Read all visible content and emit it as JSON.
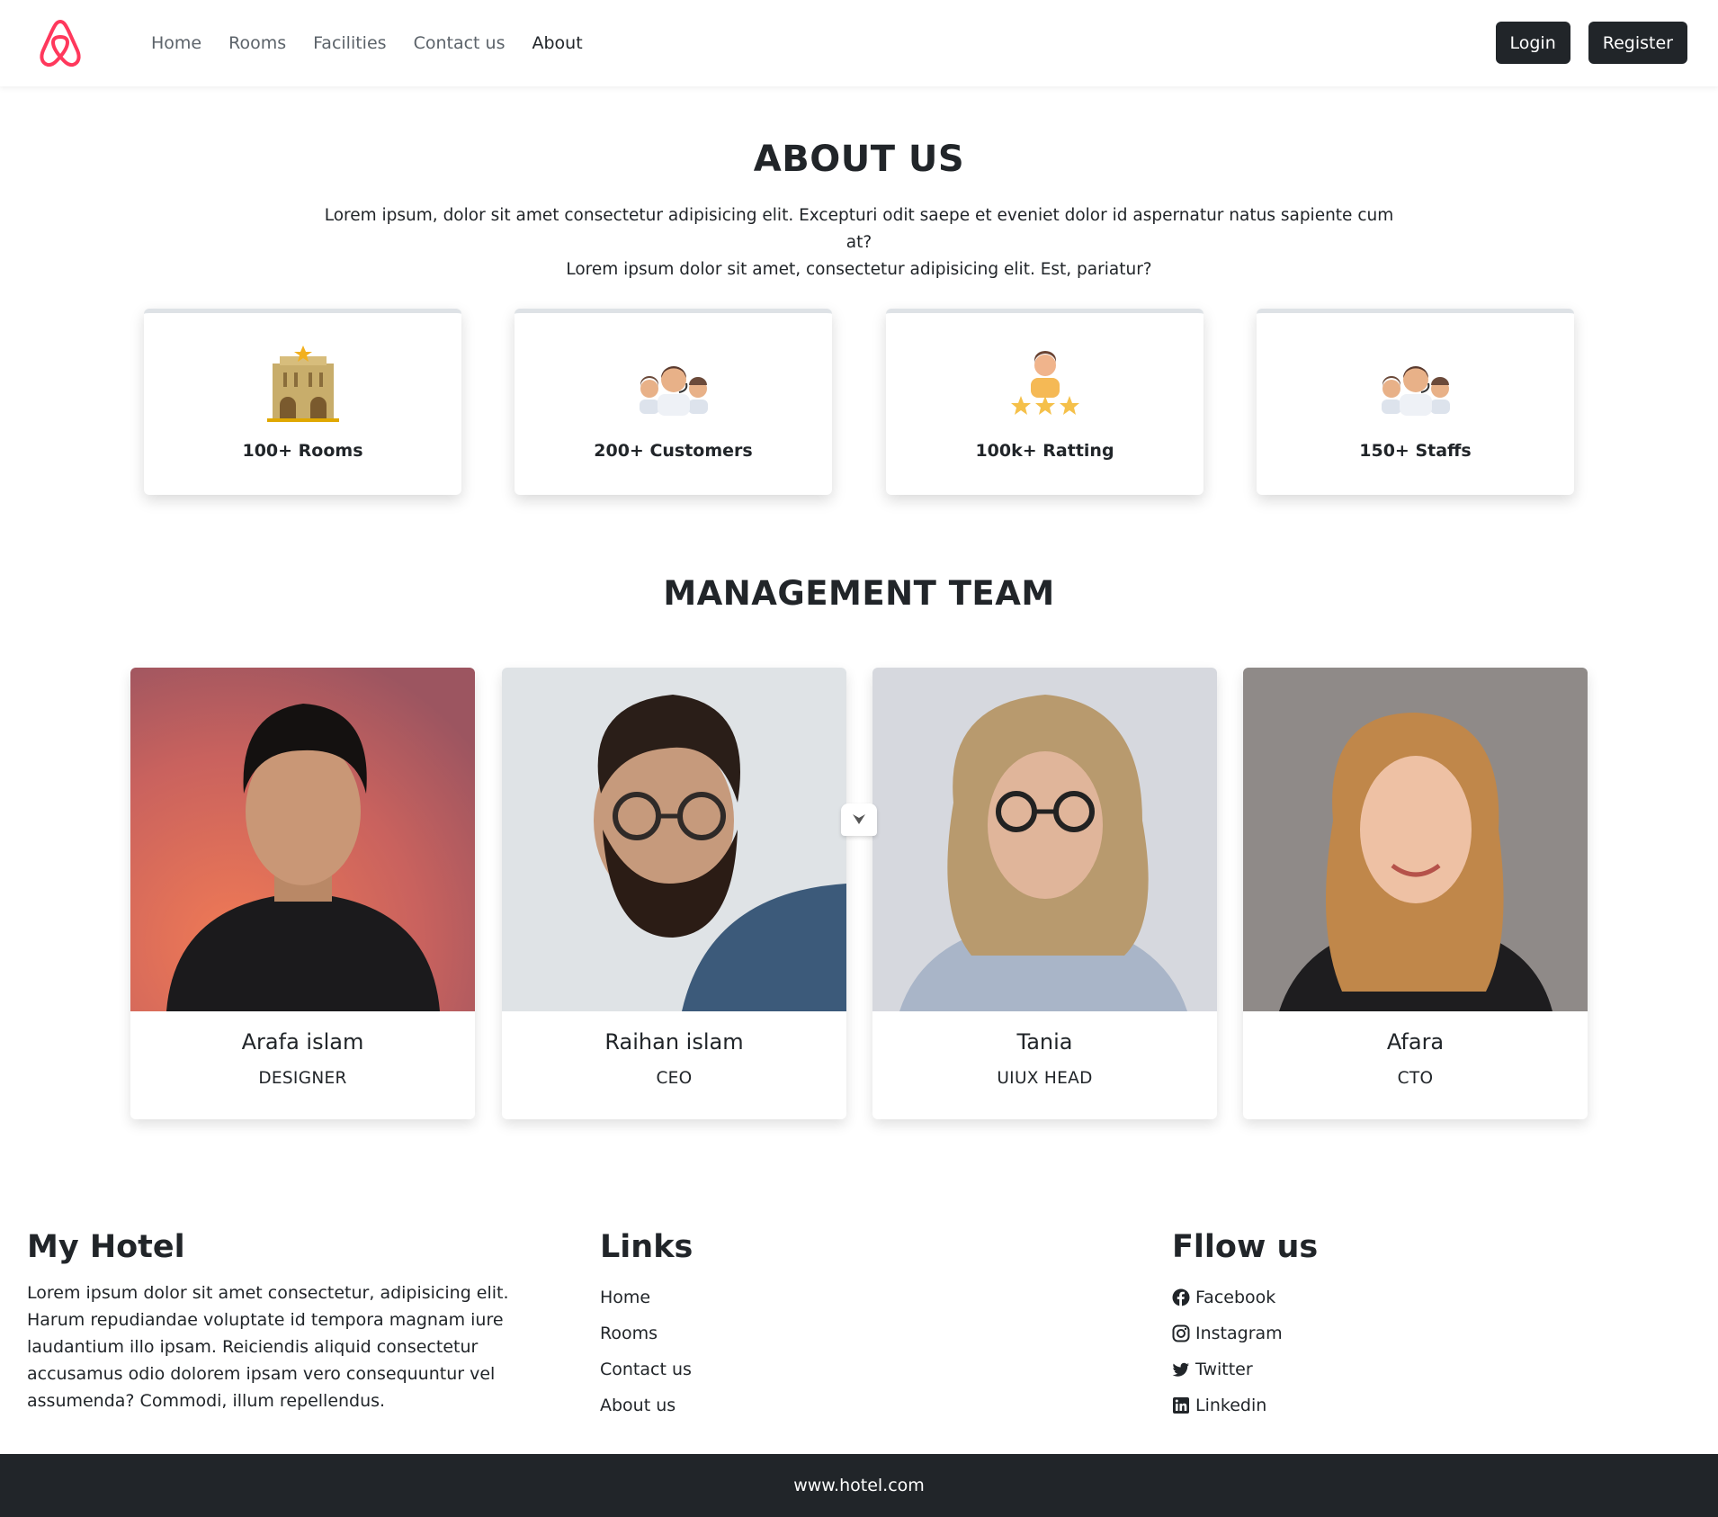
{
  "navbar": {
    "logo_icon": "airbnb-logo-icon",
    "links": [
      {
        "label": "Home",
        "active": false
      },
      {
        "label": "Rooms",
        "active": false
      },
      {
        "label": "Facilities",
        "active": false
      },
      {
        "label": "Contact us",
        "active": false
      },
      {
        "label": "About",
        "active": true
      }
    ],
    "login_label": "Login",
    "register_label": "Register"
  },
  "about": {
    "title": "ABOUT US",
    "text_line1": "Lorem ipsum, dolor sit amet consectetur adipisicing elit. Excepturi odit saepe et eveniet dolor id aspernatur natus sapiente cum at?",
    "text_line2": "Lorem ipsum dolor sit amet, consectetur adipisicing elit. Est, pariatur?",
    "stats": [
      {
        "label": "100+ Rooms",
        "icon": "hotel-building-icon"
      },
      {
        "label": "200+ Customers",
        "icon": "customers-group-icon"
      },
      {
        "label": "100k+ Ratting",
        "icon": "rating-stars-icon"
      },
      {
        "label": "150+ Staffs",
        "icon": "staff-group-icon"
      }
    ]
  },
  "team": {
    "title": "MANAGEMENT TEAM",
    "members": [
      {
        "name": "Arafa islam",
        "role": "DESIGNER"
      },
      {
        "name": "Raihan islam",
        "role": "CEO"
      },
      {
        "name": "Tania",
        "role": "UIUX HEAD"
      },
      {
        "name": "Afara",
        "role": "CTO"
      }
    ]
  },
  "footer": {
    "brand_title": "My Hotel",
    "brand_text": "Lorem ipsum dolor sit amet consectetur, adipisicing elit. Harum repudiandae voluptate id tempora magnam iure laudantium illo ipsam. Reiciendis aliquid consectetur accusamus odio dolorem ipsam vero consequuntur vel assumenda? Commodi, illum repellendus.",
    "links_title": "Links",
    "links": [
      "Home",
      "Rooms",
      "Contact us",
      "About us"
    ],
    "follow_title": "Fllow us",
    "social": [
      {
        "label": "Facebook",
        "icon": "facebook-icon"
      },
      {
        "label": "Instagram",
        "icon": "instagram-icon"
      },
      {
        "label": "Twitter",
        "icon": "twitter-icon"
      },
      {
        "label": "Linkedin",
        "icon": "linkedin-icon"
      }
    ],
    "copyright": "www.hotel.com"
  },
  "colors": {
    "brand": "#ff385c",
    "dark": "#212529",
    "muted": "#5c636a"
  }
}
